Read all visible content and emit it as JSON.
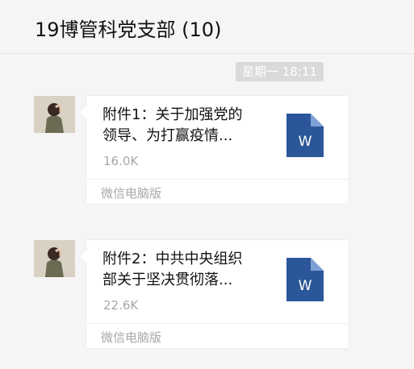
{
  "header": {
    "title": "19博管科党支部 (10)"
  },
  "time_divider": "星期一 18:11",
  "messages": [
    {
      "file_name_line1": "附件1：关于加强党的",
      "file_name_line2": "领导、为打赢疫情...",
      "file_size": "16.0K",
      "file_icon": "W",
      "source": "微信电脑版"
    },
    {
      "file_name_line1": "附件2：中共中央组织",
      "file_name_line2": "部关于坚决贯彻落...",
      "file_size": "22.6K",
      "file_icon": "W",
      "source": "微信电脑版"
    }
  ],
  "colors": {
    "word_icon": "#2b579a",
    "word_icon_fold": "#7fa0d4"
  }
}
